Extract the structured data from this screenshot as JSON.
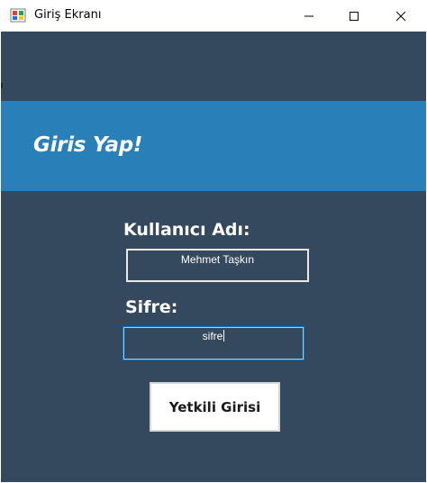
{
  "window": {
    "title": "Giriş Ekranı",
    "icons": {
      "app": "winforms-app-icon",
      "minimize": "minimize-icon",
      "maximize": "maximize-icon",
      "close": "close-icon"
    }
  },
  "banner": {
    "title": "Giris Yap!"
  },
  "form": {
    "username_label": "Kullanıcı Adı:",
    "username_value": "Mehmet Taşkın",
    "password_label": "Sifre:",
    "password_value": "sifre",
    "login_button": "Yetkili Girisi"
  },
  "colors": {
    "background": "#34495e",
    "banner": "#2980b9",
    "text": "#ffffff",
    "focus_border": "#0078d7"
  }
}
